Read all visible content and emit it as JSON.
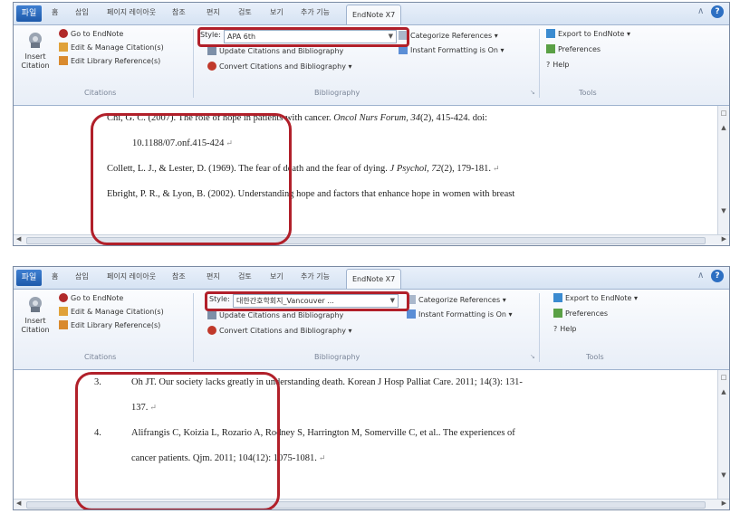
{
  "ribbon": {
    "tabs": [
      "파일",
      "홈",
      "삽입",
      "페이지 레이아웃",
      "참조",
      "편지",
      "검토",
      "보기",
      "추가 기능",
      "EndNote X7"
    ],
    "insert_citation": "Insert Citation",
    "go_to_endnote": "Go to EndNote",
    "edit_manage": "Edit & Manage Citation(s)",
    "edit_library": "Edit Library Reference(s)",
    "citations_group": "Citations",
    "style_label": "Style:",
    "update_citations": "Update Citations and Bibliography",
    "convert_citations": "Convert Citations and Bibliography",
    "bibliography_group": "Bibliography",
    "categorize": "Categorize References",
    "instant_formatting": "Instant Formatting is On",
    "export": "Export to EndNote",
    "preferences": "Preferences",
    "help": "Help",
    "tools_group": "Tools"
  },
  "screenshot1": {
    "style_value": "APA 6th",
    "refs": {
      "r1_a": "Chi, G. C. (2007). The role of hope in patients with cancer. ",
      "r1_journal": "Oncol Nurs Forum, 34",
      "r1_b": "(2), 415-424. doi:",
      "r1_c": "10.1188/07.onf.415-424",
      "r2_a": "Collett, L. J., & Lester, D. (1969). The fear of death and the fear of dying. ",
      "r2_journal": "J Psychol, 72",
      "r2_b": "(2), 179-181.",
      "r3": "Ebright, P. R., & Lyon, B. (2002). Understanding hope and factors that enhance hope in women with breast"
    }
  },
  "screenshot2": {
    "style_value": "대한간호학회지_Vancouver ...",
    "refs": {
      "n3": "3.",
      "r3_a": "Oh JT. Our society lacks greatly in understanding death. Korean J Hosp Palliat Care. 2011; 14(3): 131-",
      "r3_b": "137.",
      "n4": "4.",
      "r4_a": "Alifrangis C, Koizia L, Rozario A, Rodney S, Harrington M, Somerville C, et al.. The experiences of",
      "r4_b": "cancer patients. Qjm. 2011; 104(12): 1075-1081."
    }
  },
  "icons": [
    "endnote-icon",
    "edit-icon",
    "library-icon",
    "update-icon",
    "convert-icon",
    "categorize-icon",
    "instant-icon",
    "export-icon",
    "preferences-icon",
    "help-icon",
    "minimize-icon"
  ],
  "colors": {
    "highlight": "#b1202a",
    "ribbon_accent": "#2d6fc2"
  }
}
